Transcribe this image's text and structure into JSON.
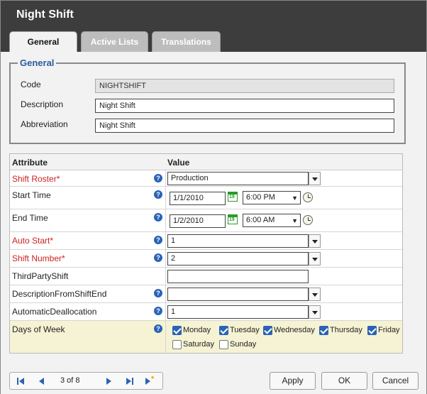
{
  "window": {
    "title": "Night Shift"
  },
  "tabs": [
    {
      "label": "General"
    },
    {
      "label": "Active Lists"
    },
    {
      "label": "Translations"
    }
  ],
  "general": {
    "legend": "General",
    "code": {
      "label": "Code",
      "value": "NIGHTSHIFT"
    },
    "description": {
      "label": "Description",
      "value": "Night Shift"
    },
    "abbreviation": {
      "label": "Abbreviation",
      "value": "Night Shift"
    }
  },
  "grid": {
    "headers": {
      "attribute": "Attribute",
      "value": "Value"
    },
    "shift_roster": {
      "label": "Shift Roster*",
      "value": "Production"
    },
    "start_time": {
      "label": "Start Time",
      "date": "1/1/2010",
      "time": "6:00 PM"
    },
    "end_time": {
      "label": "End Time",
      "date": "1/2/2010",
      "time": "6:00 AM"
    },
    "auto_start": {
      "label": "Auto Start*",
      "value": "1"
    },
    "shift_number": {
      "label": "Shift Number*",
      "value": "2"
    },
    "third_party_shift": {
      "label": "ThirdPartyShift",
      "value": ""
    },
    "description_from_shift_end": {
      "label": "DescriptionFromShiftEnd",
      "value": ""
    },
    "automatic_deallocation": {
      "label": "AutomaticDeallocation",
      "value": "1"
    },
    "days_of_week": {
      "label": "Days of Week",
      "days": [
        {
          "label": "Monday",
          "checked": true
        },
        {
          "label": "Tuesday",
          "checked": true
        },
        {
          "label": "Wednesday",
          "checked": true
        },
        {
          "label": "Thursday",
          "checked": true
        },
        {
          "label": "Friday",
          "checked": true
        },
        {
          "label": "Saturday",
          "checked": false
        },
        {
          "label": "Sunday",
          "checked": false
        }
      ]
    }
  },
  "calendar_icon_text": "19",
  "help_icon_text": "?",
  "pager": {
    "text": "3 of 8"
  },
  "buttons": {
    "apply": "Apply",
    "ok": "OK",
    "cancel": "Cancel"
  },
  "colors": {
    "accent": "#2a63b8",
    "titlebar": "#3d3d3d",
    "required": "#cc2222",
    "days_row_bg": "#f5f3d3"
  }
}
